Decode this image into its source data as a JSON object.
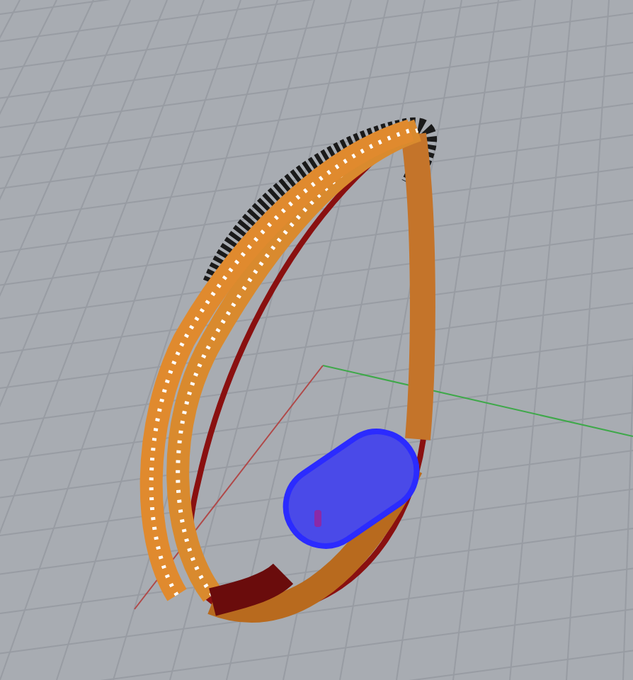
{
  "viewport": {
    "grid_visible": true,
    "axes_visible": true
  },
  "clasp": {
    "selected": true
  }
}
